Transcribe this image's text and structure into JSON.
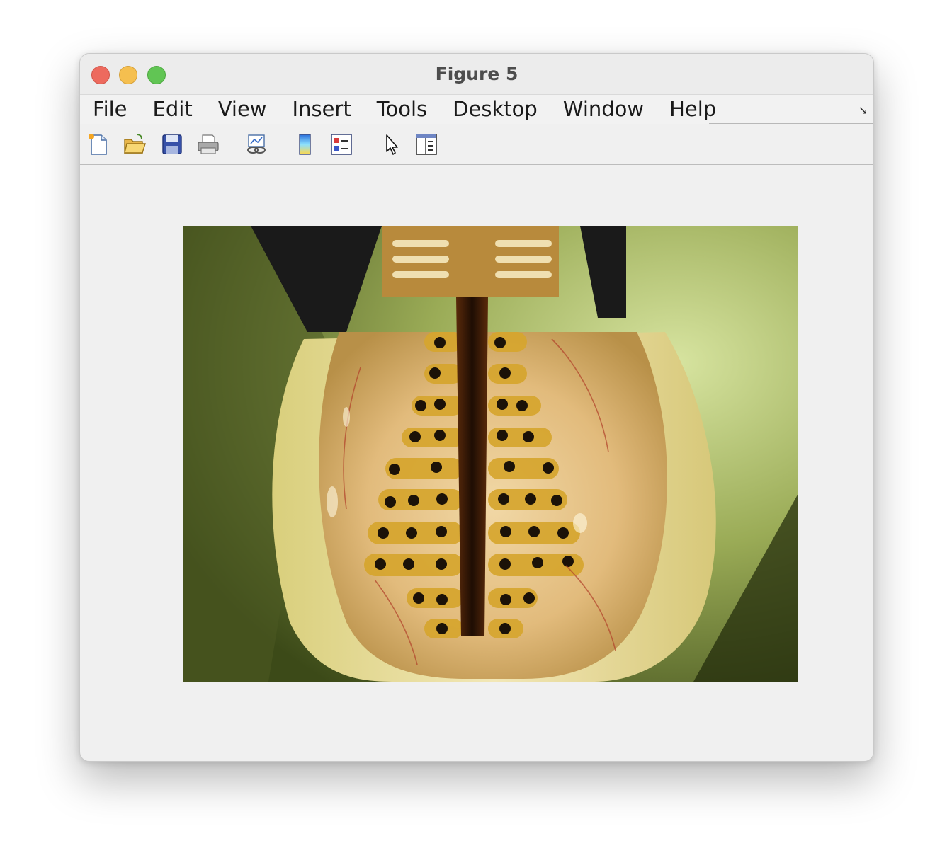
{
  "window": {
    "title": "Figure 5"
  },
  "menubar": {
    "items": [
      "File",
      "Edit",
      "View",
      "Insert",
      "Tools",
      "Desktop",
      "Window",
      "Help"
    ]
  },
  "toolbar": {
    "buttons": [
      {
        "icon": "new-figure-icon"
      },
      {
        "icon": "open-file-icon"
      },
      {
        "icon": "save-figure-icon"
      },
      {
        "icon": "print-figure-icon"
      },
      {
        "icon": "link-plot-icon"
      },
      {
        "icon": "insert-colorbar-icon"
      },
      {
        "icon": "insert-legend-icon"
      },
      {
        "icon": "edit-plot-icon"
      },
      {
        "icon": "property-inspector-icon"
      }
    ]
  },
  "figure": {
    "image": {
      "subject": "electrode-array-photo",
      "colors": {
        "background_green": "#9aab56",
        "tissue": "#e4c98a",
        "electrode_strip": "#d6a52c",
        "electrode_dot": "#1b1208"
      }
    }
  }
}
